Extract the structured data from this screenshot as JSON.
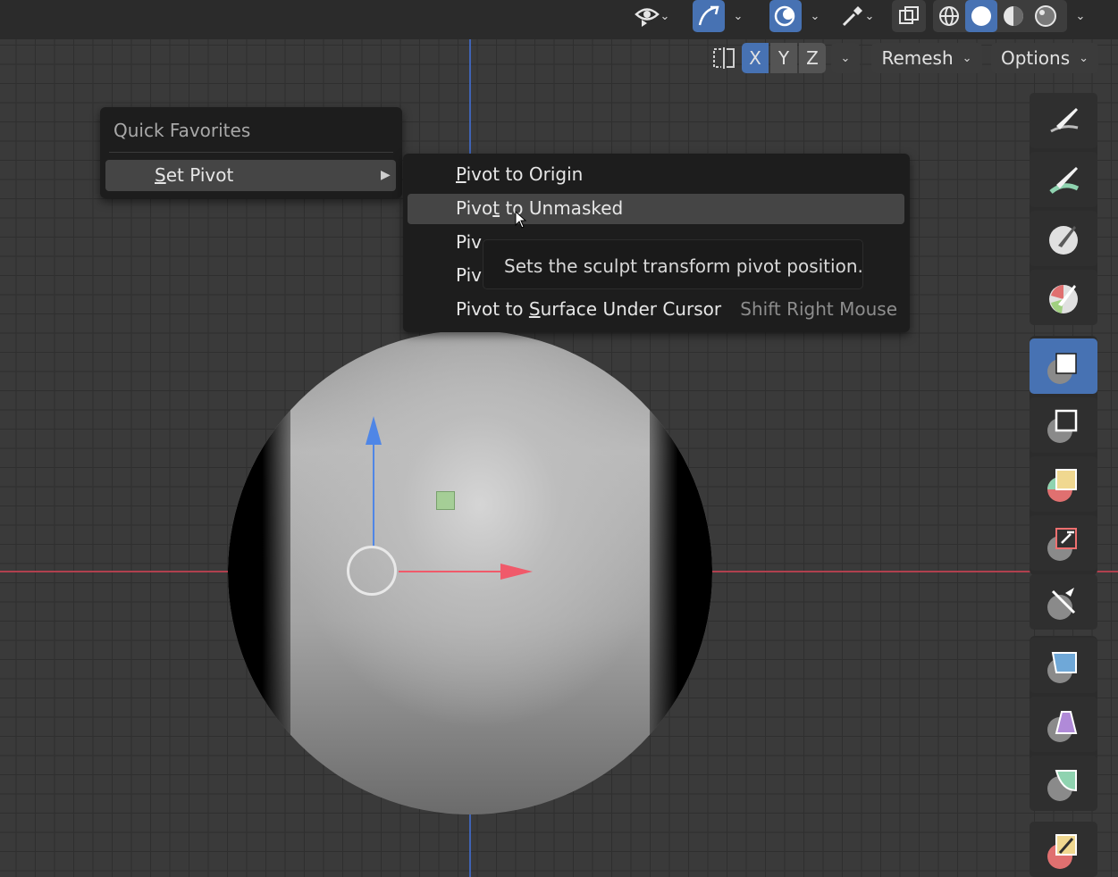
{
  "header": {
    "icons": [
      "visibility-eye-icon",
      "overlay-curve-icon",
      "xray-icon",
      "eyedropper-icon",
      "overlays-icon",
      "wireframe-shading-icon",
      "solid-shading-icon",
      "material-shading-icon",
      "rendered-shading-icon"
    ]
  },
  "toolbar": {
    "symmetry_icon": "mirror-icon",
    "axis_x": "X",
    "axis_y": "Y",
    "axis_z": "Z",
    "remesh_label": "Remesh",
    "options_label": "Options"
  },
  "quick_favorites": {
    "title": "Quick Favorites",
    "item_prefix": "",
    "item_underlined": "S",
    "item_rest": "et Pivot"
  },
  "pivot_menu": {
    "items": [
      {
        "pre": "",
        "ul": "P",
        "post": "ivot to Origin",
        "shortcut": ""
      },
      {
        "pre": "Pivo",
        "ul": "t",
        "post": " to Unmasked",
        "shortcut": ""
      },
      {
        "pre": "Piv",
        "ul": "",
        "post": "",
        "shortcut": ""
      },
      {
        "pre": "Piv",
        "ul": "",
        "post": "",
        "shortcut": ""
      },
      {
        "pre": "Pivot to ",
        "ul": "S",
        "post": "urface Under Cursor",
        "shortcut": "Shift Right Mouse"
      }
    ],
    "tooltip": "Sets the sculpt transform pivot position."
  },
  "tools": [
    "draw-brush-icon",
    "smooth-brush-icon",
    "paint-brush-icon",
    "color-brush-icon",
    "mask-box-icon",
    "mask-lasso-icon",
    "face-set-icon",
    "trim-icon",
    "line-project-icon",
    "cloth-icon",
    "grab-icon",
    "simplify-icon",
    "annotate-icon"
  ],
  "colors": {
    "accent_blue": "#4772b3",
    "axis_x": "#f05a6a",
    "axis_z": "#4f86e6"
  }
}
